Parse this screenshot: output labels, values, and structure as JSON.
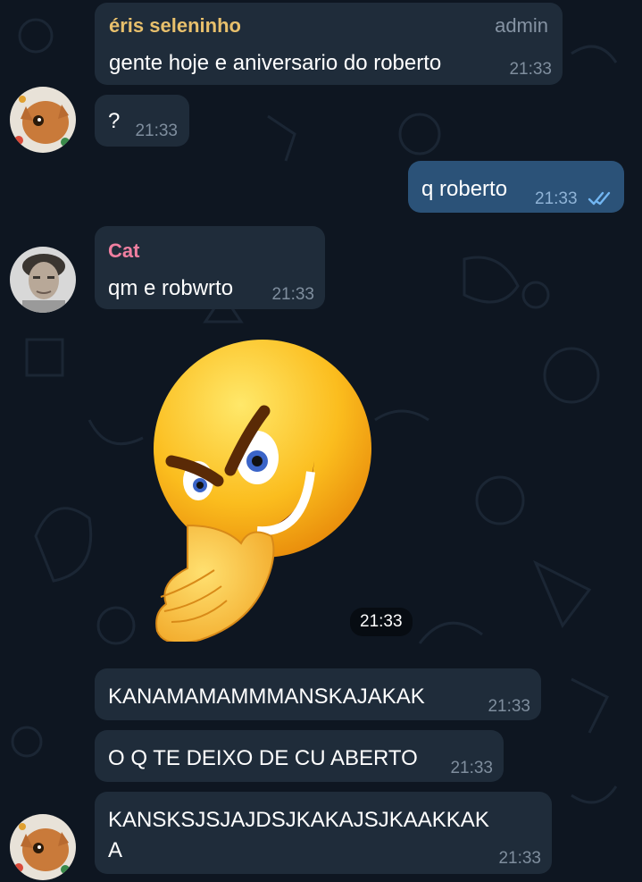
{
  "messages": [
    {
      "sender": "éris seleninho",
      "badge": "admin",
      "text": "gente hoje e aniversario do roberto",
      "time": "21:33"
    },
    {
      "text": "?",
      "time": "21:33"
    },
    {
      "text": "q roberto",
      "time": "21:33",
      "status": "read"
    },
    {
      "sender": "Cat",
      "text": "qm e robwrto",
      "time": "21:33"
    },
    {
      "sticker": "smirking-emoji",
      "time": "21:33"
    },
    {
      "text": "KANAMAMAMMMANSKAJAKAK",
      "time": "21:33"
    },
    {
      "text": "O Q TE DEIXO DE CU ABERTO",
      "time": "21:33"
    },
    {
      "text_line1": "KANSKSJSJAJDSJKAKAJSJKAAKKAK",
      "text_line2": "A",
      "time": "21:33"
    }
  ],
  "colors": {
    "background": "#0e1621",
    "incoming_bubble": "#1f2c3a",
    "outgoing_bubble": "#2b5278",
    "sender_eris": "#e8c06c",
    "sender_cat": "#ef7fa0",
    "read_check": "#72b6f2"
  },
  "icons": [
    "double-check-icon",
    "smirking-emoji-sticker",
    "avatar-cat-photo",
    "avatar-person-photo"
  ]
}
